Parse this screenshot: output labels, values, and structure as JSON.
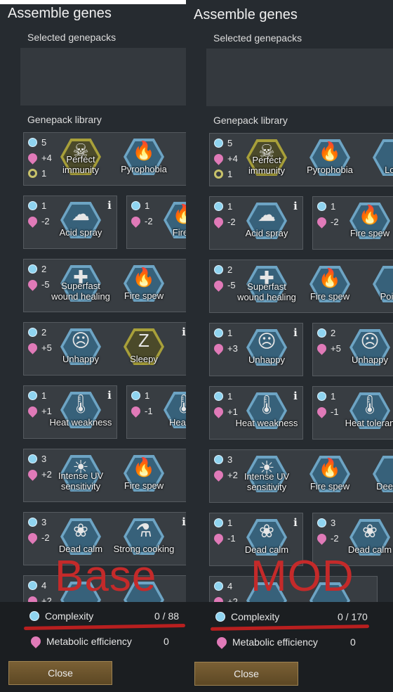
{
  "left": {
    "title": "Assemble genes",
    "selected_label": "Selected genepacks",
    "library_label": "Genepack library",
    "overlay_label": "Base",
    "complexity_label": "Complexity",
    "complexity_value": "0 / 88",
    "metabolic_label": "Metabolic efficiency",
    "metabolic_value": "0",
    "close_label": "Close",
    "rows": [
      [
        {
          "stats": [
            "5",
            "+4",
            "1"
          ],
          "genes": [
            {
              "name": "Perfect immunity",
              "icon": "perfect-immunity-icon",
              "glyph": "☠",
              "gold": true
            },
            {
              "name": "Pyrophobia",
              "icon": "pyrophobia-icon",
              "glyph": "🔥"
            }
          ],
          "info": false
        }
      ],
      [
        {
          "stats": [
            "1",
            "-2"
          ],
          "genes": [
            {
              "name": "Acid spray",
              "icon": "acid-spray-icon",
              "glyph": "☁"
            }
          ],
          "info": true
        },
        {
          "stats": [
            "1",
            "-2"
          ],
          "genes": [
            {
              "name": "Fire s",
              "icon": "fire-spew-icon",
              "glyph": "🔥"
            }
          ],
          "info": false
        }
      ],
      [
        {
          "stats": [
            "2",
            "-5"
          ],
          "genes": [
            {
              "name": "Superfast wound healing",
              "icon": "wound-healing-icon",
              "glyph": "✚"
            },
            {
              "name": "Fire spew",
              "icon": "fire-spew-icon",
              "glyph": "🔥"
            },
            {
              "name": "P",
              "icon": "gene-icon",
              "glyph": ""
            }
          ],
          "info": false
        }
      ],
      [
        {
          "stats": [
            "2",
            "+5"
          ],
          "genes": [
            {
              "name": "Unhappy",
              "icon": "unhappy-icon",
              "glyph": "☹"
            },
            {
              "name": "Sleepy",
              "icon": "sleepy-icon",
              "glyph": "Z",
              "gold": true
            }
          ],
          "info": true
        }
      ],
      [
        {
          "stats": [
            "1",
            "+1"
          ],
          "genes": [
            {
              "name": "Heat weakness",
              "icon": "heat-weakness-icon",
              "glyph": "🌡"
            }
          ],
          "info": true
        },
        {
          "stats": [
            "1",
            "-1"
          ],
          "genes": [
            {
              "name": "Heat to",
              "icon": "heat-tolerant-icon",
              "glyph": "🌡"
            }
          ],
          "info": false
        }
      ],
      [
        {
          "stats": [
            "3",
            "+2"
          ],
          "genes": [
            {
              "name": "Intense UV sensitivity",
              "icon": "uv-sensitivity-icon",
              "glyph": "☀"
            },
            {
              "name": "Fire spew",
              "icon": "fire-spew-icon",
              "glyph": "🔥"
            },
            {
              "name": "D",
              "icon": "gene-icon",
              "glyph": ""
            }
          ],
          "info": false
        }
      ],
      [
        {
          "stats": [
            "3",
            "-2"
          ],
          "genes": [
            {
              "name": "Dead calm",
              "icon": "dead-calm-icon",
              "glyph": "❀"
            },
            {
              "name": "Strong cooking",
              "icon": "strong-cooking-icon",
              "glyph": "⚗"
            }
          ],
          "info": true
        }
      ],
      [
        {
          "stats": [
            "4",
            "+2"
          ],
          "genes": [
            {
              "name": "",
              "icon": "gene-icon",
              "glyph": ""
            },
            {
              "name": "",
              "icon": "gene-icon",
              "glyph": ""
            }
          ],
          "info": false
        }
      ]
    ]
  },
  "right": {
    "title": "Assemble genes",
    "selected_label": "Selected genepacks",
    "library_label": "Genepack library",
    "overlay_label": "MOD",
    "complexity_label": "Complexity",
    "complexity_value": "0 / 170",
    "metabolic_label": "Metabolic efficiency",
    "metabolic_value": "0",
    "close_label": "Close",
    "rows": [
      [
        {
          "stats": [
            "5",
            "+4",
            "1"
          ],
          "genes": [
            {
              "name": "Perfect immunity",
              "icon": "perfect-immunity-icon",
              "glyph": "☠",
              "gold": true
            },
            {
              "name": "Pyrophobia",
              "icon": "pyrophobia-icon",
              "glyph": "🔥"
            },
            {
              "name": "Low",
              "icon": "low-icon",
              "glyph": ""
            }
          ],
          "info": false
        }
      ],
      [
        {
          "stats": [
            "1",
            "-2"
          ],
          "genes": [
            {
              "name": "Acid spray",
              "icon": "acid-spray-icon",
              "glyph": "☁"
            }
          ],
          "info": true
        },
        {
          "stats": [
            "1",
            "-2"
          ],
          "genes": [
            {
              "name": "Fire spew",
              "icon": "fire-spew-icon",
              "glyph": "🔥"
            }
          ],
          "info": false
        }
      ],
      [
        {
          "stats": [
            "2",
            "-5"
          ],
          "genes": [
            {
              "name": "Superfast wound healing",
              "icon": "wound-healing-icon",
              "glyph": "✚"
            },
            {
              "name": "Fire spew",
              "icon": "fire-spew-icon",
              "glyph": "🔥"
            },
            {
              "name": "Pointe",
              "icon": "pointed-icon",
              "glyph": ""
            }
          ],
          "info": false
        }
      ],
      [
        {
          "stats": [
            "1",
            "+3"
          ],
          "genes": [
            {
              "name": "Unhappy",
              "icon": "unhappy-icon",
              "glyph": "☹"
            }
          ],
          "info": true
        },
        {
          "stats": [
            "2",
            "+5"
          ],
          "genes": [
            {
              "name": "Unhappy",
              "icon": "unhappy-icon",
              "glyph": "☹"
            }
          ],
          "info": false
        }
      ],
      [
        {
          "stats": [
            "1",
            "+1"
          ],
          "genes": [
            {
              "name": "Heat weakness",
              "icon": "heat-weakness-icon",
              "glyph": "🌡"
            }
          ],
          "info": true
        },
        {
          "stats": [
            "1",
            "-1"
          ],
          "genes": [
            {
              "name": "Heat toleran",
              "icon": "heat-tolerant-icon",
              "glyph": "🌡"
            }
          ],
          "info": false
        }
      ],
      [
        {
          "stats": [
            "3",
            "+2"
          ],
          "genes": [
            {
              "name": "Intense UV sensitivity",
              "icon": "uv-sensitivity-icon",
              "glyph": "☀"
            },
            {
              "name": "Fire spew",
              "icon": "fire-spew-icon",
              "glyph": "🔥"
            },
            {
              "name": "Deep sk",
              "icon": "gene-icon",
              "glyph": ""
            }
          ],
          "info": false
        }
      ],
      [
        {
          "stats": [
            "1",
            "-1"
          ],
          "genes": [
            {
              "name": "Dead calm",
              "icon": "dead-calm-icon",
              "glyph": "❀"
            }
          ],
          "info": true
        },
        {
          "stats": [
            "3",
            "-2"
          ],
          "genes": [
            {
              "name": "Dead calm",
              "icon": "dead-calm-icon",
              "glyph": "❀"
            }
          ],
          "info": false
        }
      ],
      [
        {
          "stats": [
            "4",
            "+2"
          ],
          "genes": [
            {
              "name": "",
              "icon": "gene-icon",
              "glyph": ""
            },
            {
              "name": "",
              "icon": "gene-icon",
              "glyph": ""
            }
          ],
          "info": false
        }
      ]
    ]
  }
}
